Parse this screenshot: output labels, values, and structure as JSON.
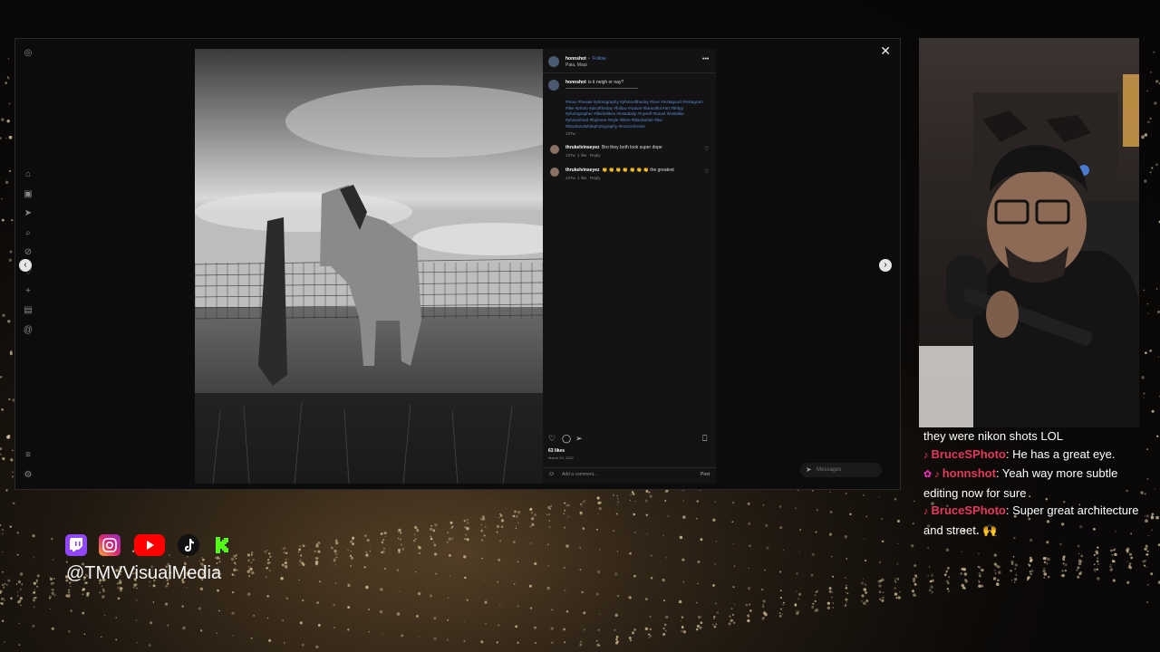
{
  "post": {
    "username": "honnshot",
    "follow_label": "Follow",
    "location": "Paia, Maui",
    "caption": "is it neigh or nay?",
    "hashtags": "#maui #hawaii #photography #photooftheday #love #instagood #instagram #like #photo #picoftheday #follow #nature #beautiful #art #bhfyp #photographer #likeforlikes #instadaily #myself #travel #instalike #photoshoot #fujinone #style #likes #blackwhite #bw #blackandwhitephotography #monochrome",
    "caption_time": "137w",
    "comments": [
      {
        "user": "thrukelvinseyez",
        "text": "Bro they both look super dope",
        "time": "137w",
        "likes": "1 like",
        "reply": "Reply"
      },
      {
        "user": "thrukelvinseyez",
        "text": "👏 👏 👏 👏 👏 👏 👏 the greatest",
        "time": "137w",
        "likes": "1 like",
        "reply": "Reply"
      }
    ],
    "like_count": "63 likes",
    "date": "March 24, 2022",
    "comment_placeholder": "Add a comment...",
    "post_button": "Post",
    "messages_label": "Messages"
  },
  "chat": [
    {
      "user": "",
      "text": "they were nikon shots LOL"
    },
    {
      "user": "BruceSPhoto",
      "text": ": He has a great eye."
    },
    {
      "user": "honnshot",
      "text": ": Yeah way more subtle editing now for sure"
    },
    {
      "user": "BruceSPhoto",
      "text": ": Super great architecture and street. 🙌"
    }
  ],
  "overlay": {
    "handle": "@TMVVisualMedia"
  },
  "colors": {
    "link": "#5b8bd8",
    "chat_user": "#e23a5a",
    "twitch": "#9146ff",
    "youtube": "#ff0000",
    "kick": "#53fc18"
  },
  "icons": {
    "sidebar": [
      "instagram-icon",
      "home-icon",
      "reels-icon",
      "explore-icon",
      "search-icon",
      "compass-icon",
      "messages-icon",
      "create-icon",
      "reels2-icon",
      "threads-icon",
      "menu-icon",
      "more-icon"
    ],
    "socials": [
      "twitch-icon",
      "instagram-icon",
      "youtube-icon",
      "tiktok-icon",
      "kick-icon"
    ]
  }
}
